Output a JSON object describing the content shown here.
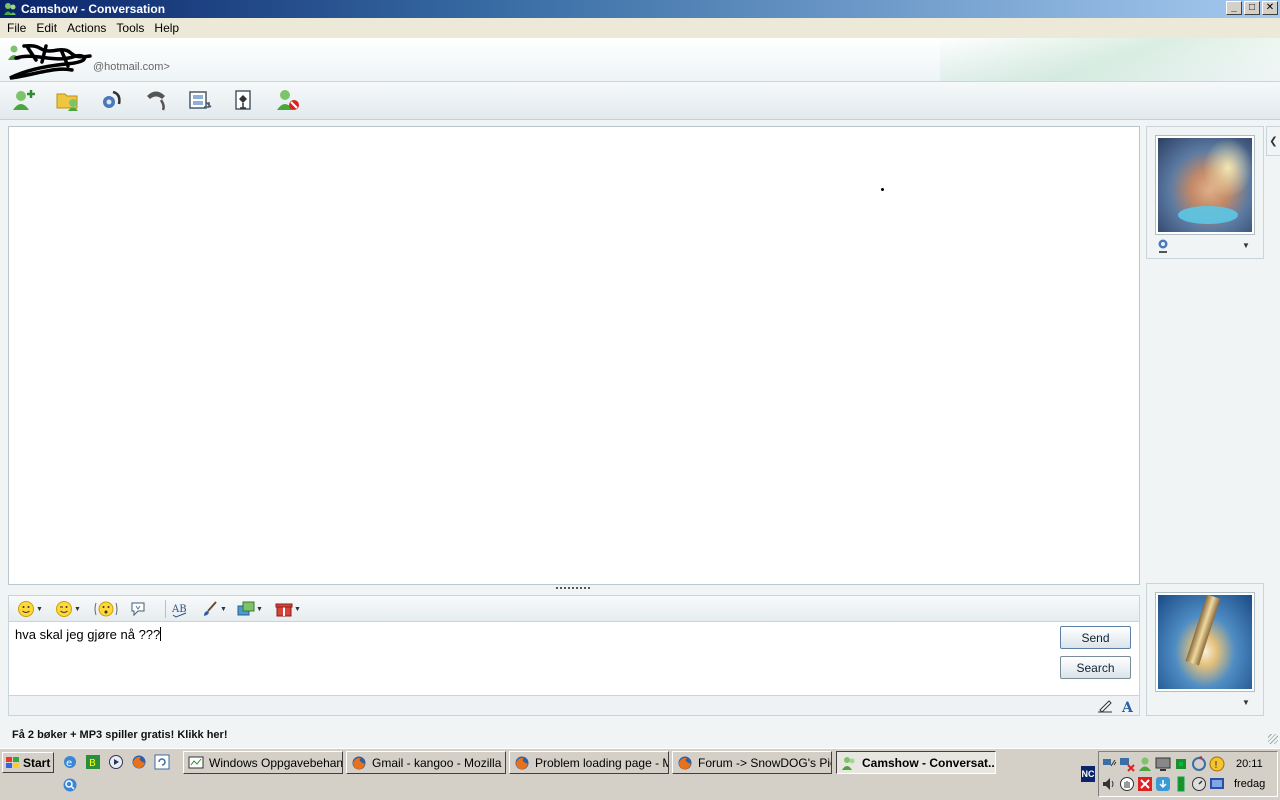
{
  "window": {
    "title": "Camshow - Conversation",
    "min": "_",
    "max": "□",
    "close": "✕"
  },
  "menu": [
    "File",
    "Edit",
    "Actions",
    "Tools",
    "Help"
  ],
  "contact": {
    "email_suffix": "@hotmail.com>"
  },
  "toolbar_icons": [
    "invite-contact-icon",
    "send-files-icon",
    "video-call-icon",
    "phone-call-icon",
    "activities-icon",
    "games-icon",
    "block-contact-icon"
  ],
  "compose_toolbar_icons": [
    "emoticon-icon",
    "wink-icon",
    "nudge-icon",
    "voice-clip-icon",
    "spell-check-icon",
    "font-brush-icon",
    "background-icon",
    "gift-icon"
  ],
  "compose": {
    "text": "hva skal jeg gjøre nå ???"
  },
  "buttons": {
    "send": "Send",
    "search": "Search"
  },
  "ad": {
    "text": "Få 2 bøker + MP3 spiller gratis! Klikk her!"
  },
  "taskbar": {
    "start": "Start",
    "tasks": [
      {
        "label": "Windows Oppgavebehan...",
        "icon": "task-manager-icon"
      },
      {
        "label": "Gmail - kangoo - Mozilla F...",
        "icon": "firefox-icon"
      },
      {
        "label": "Problem loading page - M...",
        "icon": "firefox-icon"
      },
      {
        "label": "Forum -> SnowDOG's Pic...",
        "icon": "firefox-icon"
      },
      {
        "label": "Camshow - Conversat...",
        "icon": "messenger-icon",
        "active": true
      }
    ],
    "tray_badge": "NC",
    "clock": "20:11",
    "day": "fredag"
  },
  "colors": {
    "titlebar": "#0a246a",
    "accent": "#3a6ea5",
    "panel": "#f1f4f5"
  }
}
